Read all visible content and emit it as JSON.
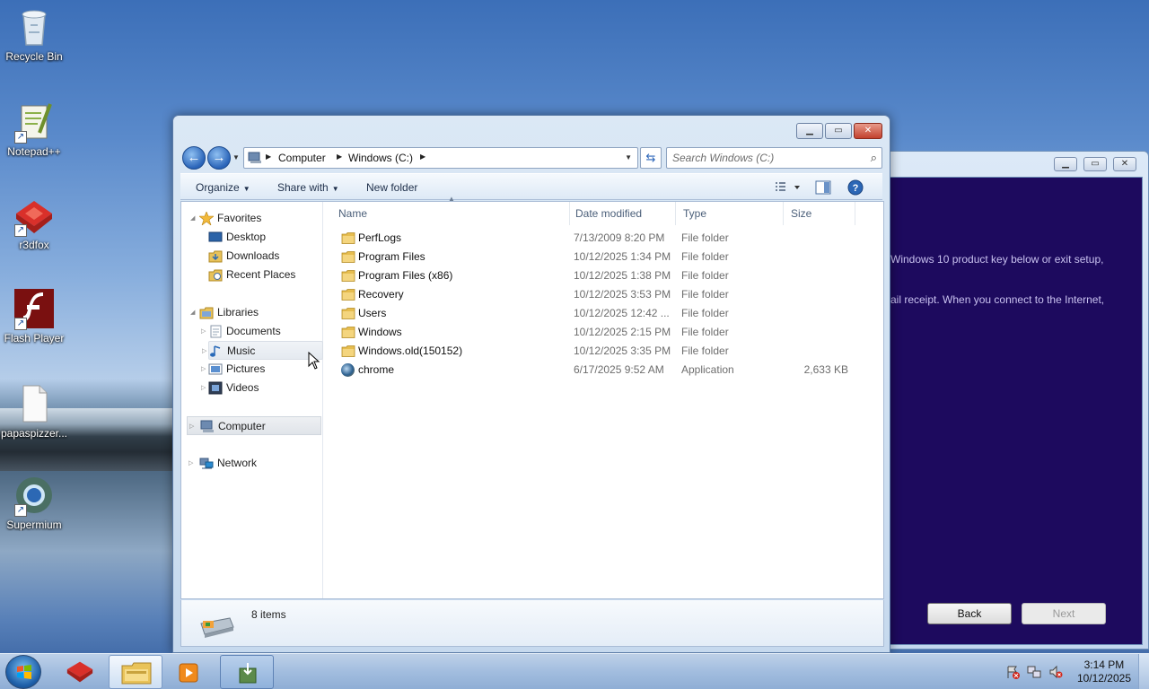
{
  "desktop": {
    "icons": [
      {
        "label": "Recycle Bin"
      },
      {
        "label": "Notepad++"
      },
      {
        "label": "r3dfox"
      },
      {
        "label": "Flash Player"
      },
      {
        "label": "papaspizzer..."
      },
      {
        "label": "Supermium"
      }
    ]
  },
  "setup_window": {
    "text_line1": "Windows 10 product key below or exit setup,",
    "text_line2": "ail receipt. When you connect to the Internet,",
    "back_label": "Back",
    "next_label": "Next",
    "bg_color": "#1d0a5e"
  },
  "explorer": {
    "address": {
      "segments": [
        "Computer",
        "Windows (C:)"
      ]
    },
    "search": {
      "placeholder": "Search Windows (C:)"
    },
    "toolbar": {
      "organize": "Organize",
      "share_with": "Share with",
      "new_folder": "New folder"
    },
    "nav": {
      "favorites": "Favorites",
      "desktop": "Desktop",
      "downloads": "Downloads",
      "recent_places": "Recent Places",
      "libraries": "Libraries",
      "documents": "Documents",
      "music": "Music",
      "pictures": "Pictures",
      "videos": "Videos",
      "computer": "Computer",
      "network": "Network"
    },
    "columns": {
      "name": "Name",
      "date_modified": "Date modified",
      "type": "Type",
      "size": "Size"
    },
    "files": [
      {
        "name": "PerfLogs",
        "date": "7/13/2009 8:20 PM",
        "type": "File folder",
        "size": ""
      },
      {
        "name": "Program Files",
        "date": "10/12/2025 1:34 PM",
        "type": "File folder",
        "size": ""
      },
      {
        "name": "Program Files (x86)",
        "date": "10/12/2025 1:38 PM",
        "type": "File folder",
        "size": ""
      },
      {
        "name": "Recovery",
        "date": "10/12/2025 3:53 PM",
        "type": "File folder",
        "size": ""
      },
      {
        "name": "Users",
        "date": "10/12/2025 12:42 ...",
        "type": "File folder",
        "size": ""
      },
      {
        "name": "Windows",
        "date": "10/12/2025 2:15 PM",
        "type": "File folder",
        "size": ""
      },
      {
        "name": "Windows.old(150152)",
        "date": "10/12/2025 3:35 PM",
        "type": "File folder",
        "size": ""
      },
      {
        "name": "chrome",
        "date": "6/17/2025 9:52 AM",
        "type": "Application",
        "size": "2,633 KB"
      }
    ],
    "status": {
      "item_count": "8 items"
    }
  },
  "taskbar": {
    "clock_time": "3:14 PM",
    "clock_date": "10/12/2025"
  },
  "colors": {
    "accent": "#2a64b8",
    "window_chrome": "#c6d9ee",
    "close_button": "#c2412e"
  }
}
